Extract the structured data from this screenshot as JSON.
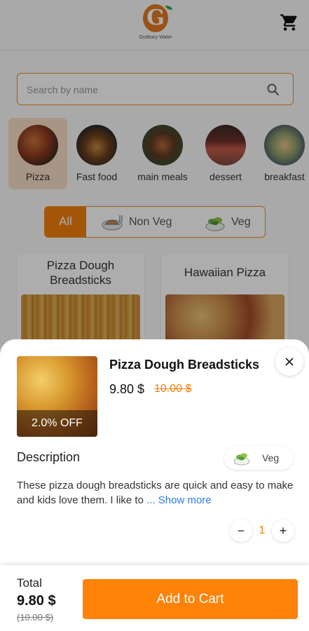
{
  "header": {
    "logo_text": "Godeary Water"
  },
  "search": {
    "placeholder": "Search by name"
  },
  "categories": [
    {
      "label": "Pizza"
    },
    {
      "label": "Fast food"
    },
    {
      "label": "main meals"
    },
    {
      "label": "dessert"
    },
    {
      "label": "breakfast"
    }
  ],
  "filter": {
    "all": "All",
    "non_veg": "Non Veg",
    "veg": "Veg"
  },
  "products": [
    {
      "title": "Pizza Dough Breadsticks"
    },
    {
      "title": "Hawaiian Pizza"
    }
  ],
  "detail": {
    "title": "Pizza Dough Breadsticks",
    "price": "9.80 $",
    "old_price": "10.00 $",
    "discount": "2.0% OFF",
    "description_heading": "Description",
    "veg_tag": "Veg",
    "description": "These pizza dough breadsticks are quick and easy to make and kids love them. I like to",
    "show_more": "... Show more",
    "quantity": "1",
    "minus": "−",
    "plus": "+"
  },
  "footer": {
    "total_label": "Total",
    "total_price": "9.80 $",
    "total_old": "(10.00 $)",
    "add_to_cart": "Add to Cart"
  },
  "colors": {
    "accent": "#f27f0c",
    "link": "#2a7be4"
  }
}
